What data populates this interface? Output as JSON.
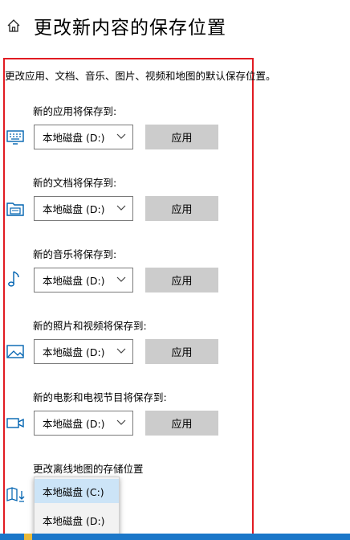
{
  "header": {
    "title": "更改新内容的保存位置",
    "icon": "home-icon"
  },
  "description": "更改应用、文档、音乐、图片、视频和地图的默认保存位置。",
  "sections": [
    {
      "label": "新的应用将保存到:",
      "icon": "monitor-icon",
      "dropdown_value": "本地磁盘 (D:)",
      "button": "应用"
    },
    {
      "label": "新的文档将保存到:",
      "icon": "folder-icon",
      "dropdown_value": "本地磁盘 (D:)",
      "button": "应用"
    },
    {
      "label": "新的音乐将保存到:",
      "icon": "music-note-icon",
      "dropdown_value": "本地磁盘 (D:)",
      "button": "应用"
    },
    {
      "label": "新的照片和视频将保存到:",
      "icon": "picture-icon",
      "dropdown_value": "本地磁盘 (D:)",
      "button": "应用"
    },
    {
      "label": "新的电影和电视节目将保存到:",
      "icon": "video-camera-icon",
      "dropdown_value": "本地磁盘 (D:)",
      "button": "应用"
    }
  ],
  "maps": {
    "label": "更改离线地图的存储位置",
    "icon": "map-download-icon",
    "options": [
      "本地磁盘 (C:)",
      "本地磁盘 (D:)"
    ],
    "selected": "本地磁盘 (C:)"
  },
  "colors": {
    "highlight_frame": "#e11b22",
    "icon_blue": "#0063b1",
    "button_bg": "#cccccc",
    "selection_bg": "#cce4f7"
  }
}
